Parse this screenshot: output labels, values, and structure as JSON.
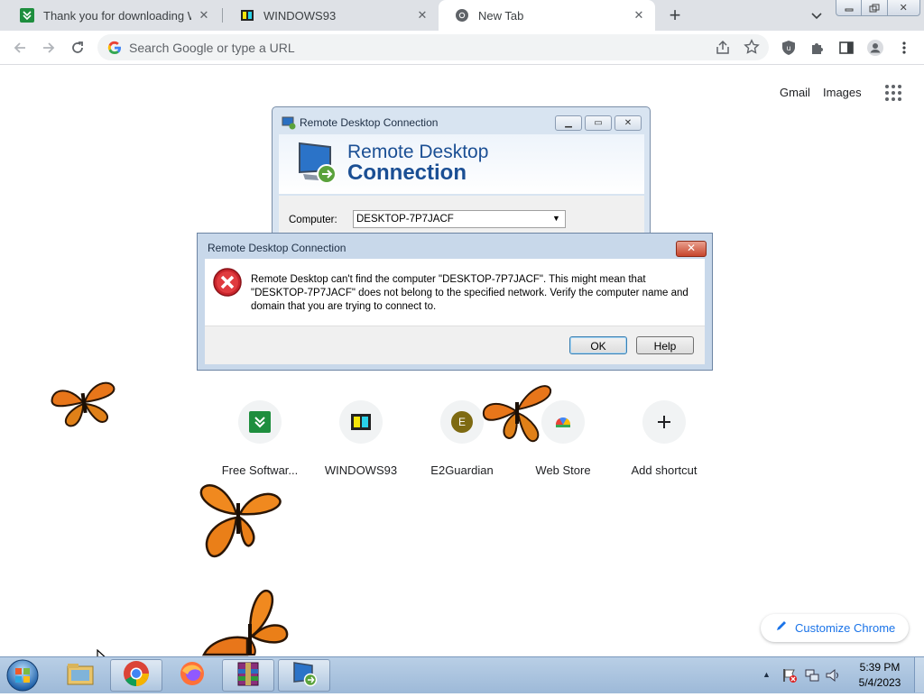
{
  "browser": {
    "tabs": [
      {
        "title": "Thank you for downloading WinR",
        "favicon": "download-green-icon",
        "active": false
      },
      {
        "title": "WINDOWS93",
        "favicon": "windows93-icon",
        "active": false
      },
      {
        "title": "New Tab",
        "favicon": "chrome-icon",
        "active": true
      }
    ],
    "new_tab_symbol": "+",
    "address_placeholder": "Search Google or type a URL"
  },
  "ntp": {
    "gmail": "Gmail",
    "images": "Images",
    "shortcuts": [
      {
        "label": "Free Softwar...",
        "icon": "download-green-icon"
      },
      {
        "label": "WINDOWS93",
        "icon": "windows93-icon"
      },
      {
        "label": "E2Guardian",
        "icon": "letter-e-icon",
        "letter": "E"
      },
      {
        "label": "Web Store",
        "icon": "webstore-icon"
      },
      {
        "label": "Add shortcut",
        "icon": "plus-icon"
      }
    ],
    "customize": "Customize Chrome"
  },
  "rdc_window": {
    "title": "Remote Desktop Connection",
    "banner_line1": "Remote Desktop",
    "banner_line2": "Connection",
    "computer_label": "Computer:",
    "computer_value": "DESKTOP-7P7JACF"
  },
  "error_dialog": {
    "title": "Remote Desktop Connection",
    "close_symbol": "✕",
    "message": "Remote Desktop can't find the computer \"DESKTOP-7P7JACF\". This might mean that \"DESKTOP-7P7JACF\" does not belong to the specified network.  Verify the computer name and domain that you are trying to connect to.",
    "ok_label": "OK",
    "help_label": "Help"
  },
  "taskbar": {
    "time": "5:39 PM",
    "date": "5/4/2023"
  },
  "colors": {
    "chrome_tabstrip": "#dee1e6",
    "rdc_blue": "#1b4f94",
    "taskbar": "#b9cfe6"
  }
}
